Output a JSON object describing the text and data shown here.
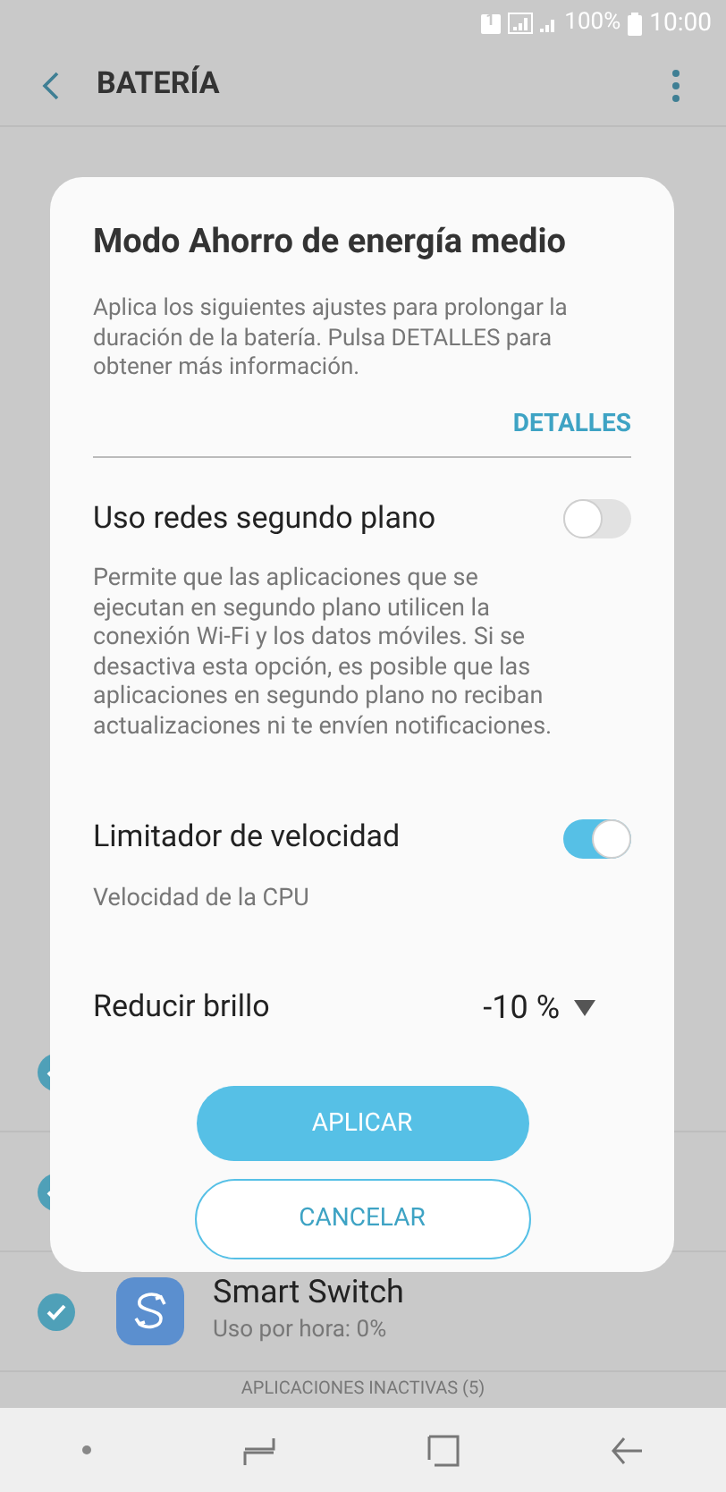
{
  "status_bar": {
    "sim_slot": "1",
    "battery_text": "100%",
    "time": "10:00"
  },
  "header": {
    "title": "BATERÍA"
  },
  "apps": [
    {
      "checked": true
    },
    {
      "checked": true
    },
    {
      "checked": true,
      "name": "Smart Switch",
      "usage": "Uso por hora: 0%"
    }
  ],
  "inactive_apps_label": "APLICACIONES INACTIVAS (5)",
  "dialog": {
    "title": "Modo Ahorro de energía medio",
    "description": "Aplica los siguientes ajustes para prolongar la duración de la batería. Pulsa DETALLES para obtener más información.",
    "details_link": "DETALLES",
    "settings": [
      {
        "kind": "toggle",
        "label": "Uso redes segundo plano",
        "on": false,
        "description": "Permite que las aplicaciones que se ejecutan en segundo plano utilicen la conexión Wi-Fi y los datos móviles. Si se desactiva esta opción, es posible que las aplicaciones en segundo plano no reciban actualizaciones ni te envíen notificaciones."
      },
      {
        "kind": "toggle",
        "label": "Limitador de velocidad",
        "on": true,
        "description": "Velocidad de la CPU"
      },
      {
        "kind": "dropdown",
        "label": "Reducir brillo",
        "value": "-10 %"
      }
    ],
    "buttons": [
      {
        "kind": "primary",
        "label": "APLICAR"
      },
      {
        "kind": "outline",
        "label": "CANCELAR"
      }
    ]
  }
}
